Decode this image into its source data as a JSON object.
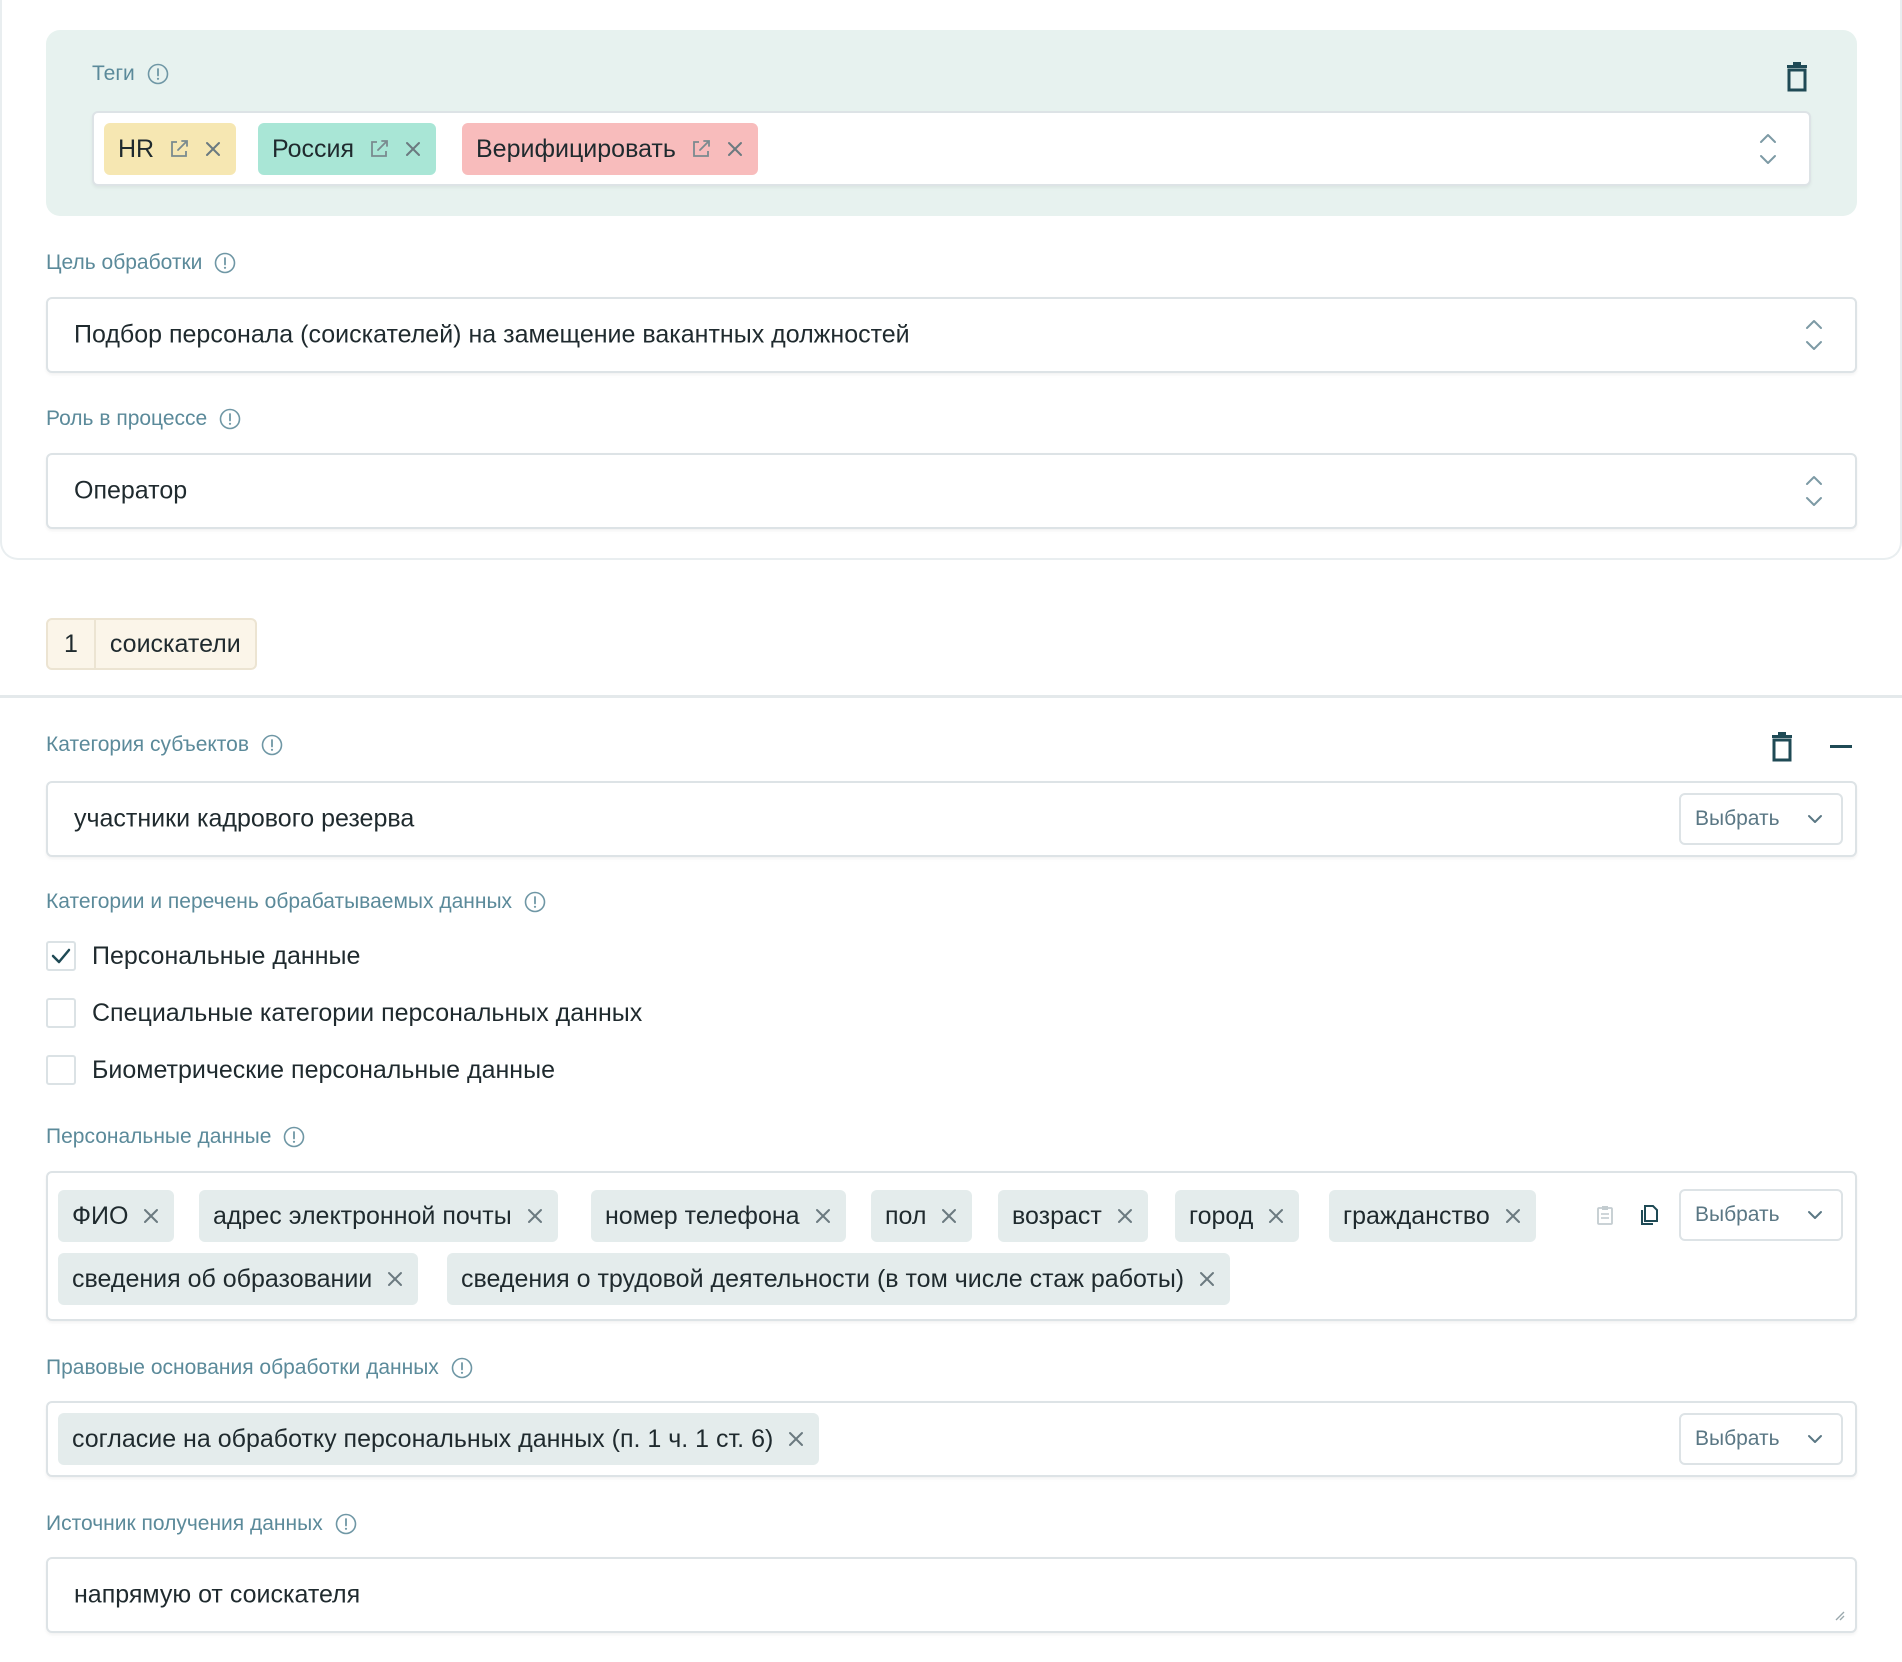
{
  "tags_section": {
    "label": "Теги",
    "tags": [
      {
        "label": "HR",
        "color": "#f6e7b2"
      },
      {
        "label": "Россия",
        "color": "#a9e6d6"
      },
      {
        "label": "Верифицировать",
        "color": "#f8bcbc"
      }
    ]
  },
  "purpose": {
    "label": "Цель обработки",
    "value": "Подбор персонала (соискателей) на замещение вакантных должностей"
  },
  "role": {
    "label": "Роль в процессе",
    "value": "Оператор"
  },
  "subject_tab": {
    "number": "1",
    "name": "соискатели"
  },
  "subject_category": {
    "label": "Категория субъектов",
    "value": "участники кадрового резерва",
    "select_label": "Выбрать"
  },
  "data_categories": {
    "label": "Категории и перечень обрабатываемых данных",
    "options": [
      {
        "label": "Персональные данные",
        "checked": true
      },
      {
        "label": "Специальные категории персональных данных",
        "checked": false
      },
      {
        "label": "Биометрические персональные данные",
        "checked": false
      }
    ]
  },
  "personal_data": {
    "label": "Персональные данные",
    "chips": [
      "ФИО",
      "адрес электронной почты",
      "номер телефона",
      "пол",
      "возраст",
      "город",
      "гражданство",
      "сведения об образовании",
      "сведения о трудовой деятельности (в том числе стаж работы)"
    ],
    "select_label": "Выбрать"
  },
  "legal_basis": {
    "label": "Правовые основания обработки данных",
    "chips": [
      "согласие на обработку персональных данных (п. 1 ч. 1 ст. 6)"
    ],
    "select_label": "Выбрать"
  },
  "data_source": {
    "label": "Источник получения данных",
    "value": "напрямую от соискателя"
  },
  "colors": {
    "tags_panel_bg": "#e7f2ef",
    "label_text": "#5b8a9a",
    "chip_bg": "#e4ecec",
    "accent": "#1f4a55"
  }
}
